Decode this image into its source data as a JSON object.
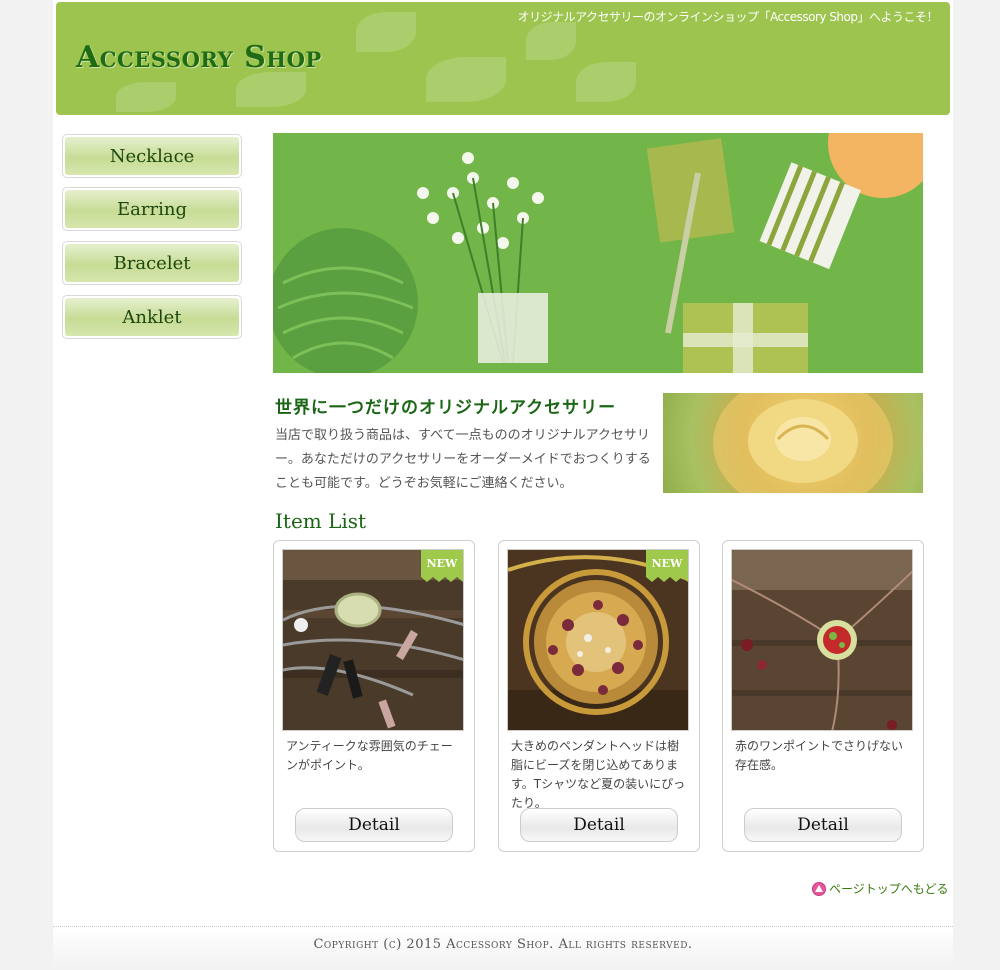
{
  "header": {
    "welcome": "オリジナルアクセサリーのオンラインショップ「Accessory Shop」へようこそ！",
    "logo": "Accessory Shop"
  },
  "sidebar": {
    "items": [
      {
        "label": "Necklace"
      },
      {
        "label": "Earring"
      },
      {
        "label": "Bracelet"
      },
      {
        "label": "Anklet"
      }
    ]
  },
  "intro": {
    "title": "世界に一つだけのオリジナルアクセサリー",
    "text": "当店で取り扱う商品は、すべて一点もののオリジナルアクセサリー。あなただけのアクセサリーをオーダーメイドでおつくりすることも可能です。どうぞお気軽にご連絡ください。"
  },
  "items": {
    "title": "Item List",
    "badge": "NEW",
    "cards": [
      {
        "desc": "アンティークな雰囲気のチェーンがポイント。",
        "button": "Detail",
        "new": true
      },
      {
        "desc": "大きめのペンダントヘッドは樹脂にビーズを閉じ込めてあります。Tシャツなど夏の装いにぴったり。",
        "button": "Detail",
        "new": true
      },
      {
        "desc": "赤のワンポイントでさりげない存在感。",
        "button": "Detail",
        "new": false
      }
    ]
  },
  "pagetop": "ページトップへもどる",
  "footer": "Copyright (c) 2015 Accessory Shop. All rights reserved.",
  "colors": {
    "header_bg": "#9dc44f",
    "accent_green": "#1a6614",
    "pagetop_icon": "#e7559a"
  }
}
